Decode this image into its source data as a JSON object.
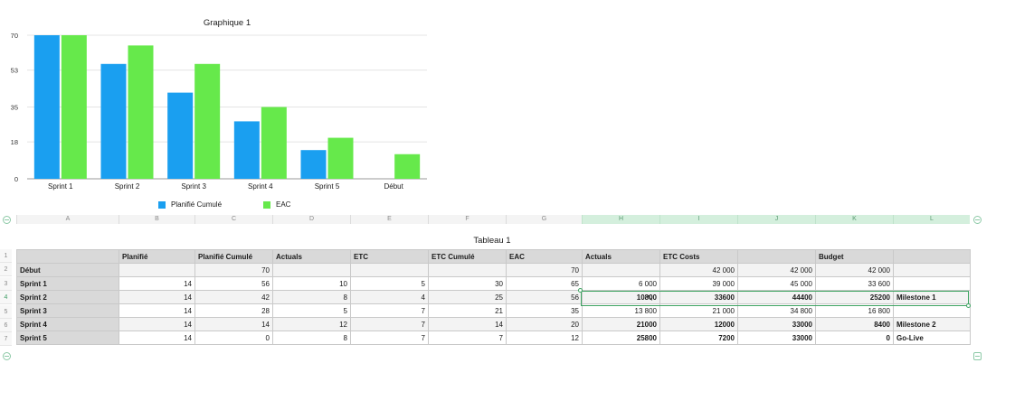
{
  "chart_data": {
    "type": "bar",
    "title": "Graphique 1",
    "categories": [
      "Sprint 1",
      "Sprint 2",
      "Sprint 3",
      "Sprint 4",
      "Sprint 5",
      "Début"
    ],
    "series": [
      {
        "name": "Planifié Cumulé",
        "values": [
          70,
          56,
          42,
          28,
          14,
          null
        ],
        "color": "#1a9ff0"
      },
      {
        "name": "EAC",
        "values": [
          70,
          65,
          56,
          35,
          20,
          12
        ],
        "color": "#66e94b"
      }
    ],
    "yticks": [
      "0",
      "18",
      "35",
      "53",
      "70"
    ],
    "ylim": [
      0,
      70
    ],
    "grid": true,
    "legend_position": "bottom"
  },
  "columns": [
    "A",
    "B",
    "C",
    "D",
    "E",
    "F",
    "G",
    "H",
    "I",
    "J",
    "K",
    "L"
  ],
  "selected_columns": [
    "H",
    "I",
    "J",
    "K",
    "L"
  ],
  "rows": [
    "1",
    "2",
    "3",
    "4",
    "5",
    "6",
    "7"
  ],
  "selected_row": "4",
  "table": {
    "title": "Tableau 1",
    "headers": [
      "",
      "Planifié",
      "Planifié Cumulé",
      "Actuals",
      "ETC",
      "ETC Cumulé",
      "EAC",
      "Actuals",
      "ETC Costs",
      "",
      "Budget",
      ""
    ],
    "body": [
      [
        "Début",
        "",
        "70",
        "",
        "",
        "",
        "70",
        "",
        "42 000",
        "42 000",
        "42 000",
        ""
      ],
      [
        "Sprint 1",
        "14",
        "56",
        "10",
        "5",
        "30",
        "65",
        "6 000",
        "39 000",
        "45 000",
        "33 600",
        ""
      ],
      [
        "Sprint 2",
        "14",
        "42",
        "8",
        "4",
        "25",
        "56",
        "10800",
        "33600",
        "44400",
        "25200",
        "Milestone 1"
      ],
      [
        "Sprint 3",
        "14",
        "28",
        "5",
        "7",
        "21",
        "35",
        "13 800",
        "21 000",
        "34 800",
        "16 800",
        ""
      ],
      [
        "Sprint 4",
        "14",
        "14",
        "12",
        "7",
        "14",
        "20",
        "21000",
        "12000",
        "33000",
        "8400",
        "Milestone 2"
      ],
      [
        "Sprint 5",
        "14",
        "0",
        "8",
        "7",
        "7",
        "12",
        "25800",
        "7200",
        "33000",
        "0",
        "Go-Live"
      ]
    ],
    "bold_rows": [
      2,
      4,
      5
    ]
  }
}
